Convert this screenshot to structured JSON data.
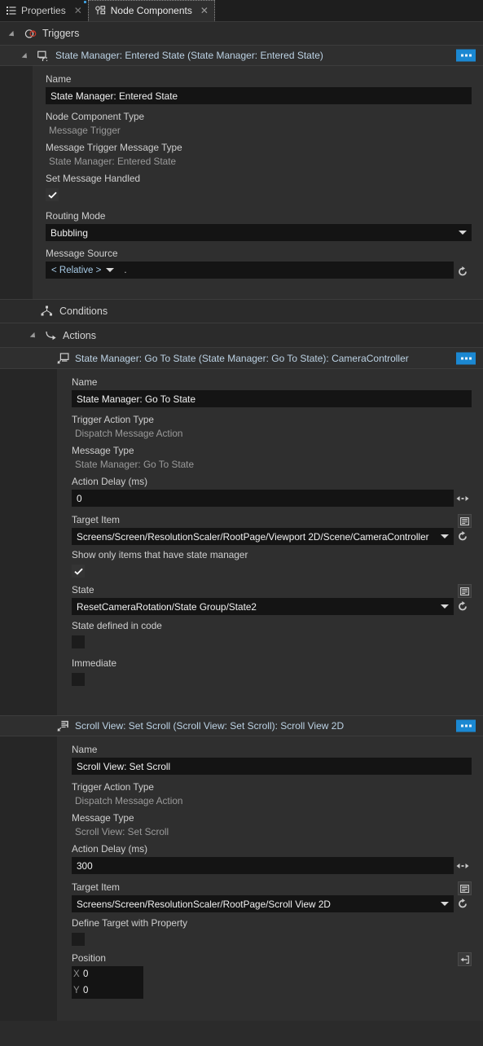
{
  "window": {
    "tabs": [
      {
        "label": "Properties",
        "icon": "list-icon",
        "active": false,
        "close": "✕"
      },
      {
        "label": "Node Components",
        "icon": "node-components-icon",
        "active": true,
        "close": "✕"
      }
    ]
  },
  "colors": {
    "accent_blue": "#1b88d2",
    "caption_text": "#b6cde0",
    "panel_bg": "#2f2f2f",
    "field_bg": "#141414",
    "trigger_red": "#c0392b"
  },
  "tree": {
    "triggers": {
      "label": "Triggers",
      "icon": "trigger-icon",
      "expanded": true
    },
    "conditions": {
      "label": "Conditions",
      "icon": "conditions-icon",
      "expanded": false
    },
    "actions": {
      "label": "Actions",
      "icon": "actions-icon",
      "expanded": true
    }
  },
  "trigger": {
    "caption": "State Manager: Entered State (State Manager: Entered State)",
    "icon": "message-trigger-icon",
    "menu_label": "…",
    "fields": {
      "name_label": "Name",
      "name_value": "State Manager: Entered State",
      "node_component_type_label": "Node Component Type",
      "node_component_type_value": "Message Trigger",
      "message_trigger_message_type_label": "Message Trigger Message Type",
      "message_trigger_message_type_value": "State Manager: Entered State",
      "set_message_handled_label": "Set Message Handled",
      "set_message_handled_checked": true,
      "routing_mode_label": "Routing Mode",
      "routing_mode_value": "Bubbling",
      "message_source_label": "Message Source",
      "message_source_scope": "< Relative >",
      "message_source_path": "."
    }
  },
  "actions": [
    {
      "caption": "State Manager: Go To State (State Manager: Go To State): CameraController",
      "icon": "dispatch-action-icon",
      "fields": {
        "name_label": "Name",
        "name_value": "State Manager: Go To State",
        "trigger_action_type_label": "Trigger Action Type",
        "trigger_action_type_value": "Dispatch Message Action",
        "message_type_label": "Message Type",
        "message_type_value": "State Manager: Go To State",
        "action_delay_label": "Action Delay (ms)",
        "action_delay_value": "0",
        "target_item_label": "Target Item",
        "target_item_value": "Screens/Screen/ResolutionScaler/RootPage/Viewport 2D/Scene/CameraController",
        "show_only_label": "Show only items that have state manager",
        "show_only_checked": true,
        "state_label": "State",
        "state_value": "ResetCameraRotation/State Group/State2",
        "state_defined_label": "State defined in code",
        "state_defined_checked": false,
        "immediate_label": "Immediate",
        "immediate_checked": false
      }
    },
    {
      "caption": "Scroll View: Set Scroll (Scroll View: Set Scroll): Scroll View 2D",
      "icon": "scroll-action-icon",
      "fields": {
        "name_label": "Name",
        "name_value": "Scroll View: Set Scroll",
        "trigger_action_type_label": "Trigger Action Type",
        "trigger_action_type_value": "Dispatch Message Action",
        "message_type_label": "Message Type",
        "message_type_value": "Scroll View: Set Scroll",
        "action_delay_label": "Action Delay (ms)",
        "action_delay_value": "300",
        "target_item_label": "Target Item",
        "target_item_value": "Screens/Screen/ResolutionScaler/RootPage/Scroll View 2D",
        "define_target_label": "Define Target with Property",
        "define_target_checked": false,
        "position_label": "Position",
        "position_x_axis": "X",
        "position_x_value": "0",
        "position_y_axis": "Y",
        "position_y_value": "0"
      }
    }
  ]
}
